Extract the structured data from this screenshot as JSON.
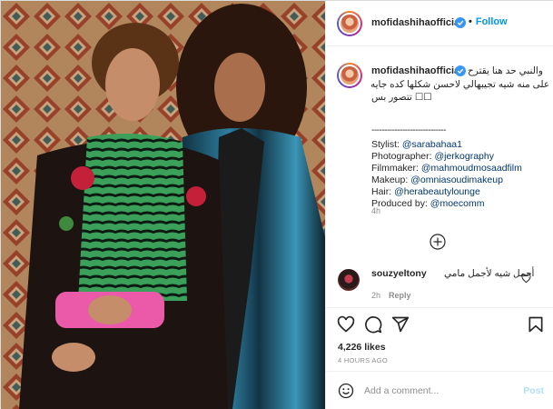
{
  "header": {
    "username": "mofidashihaofficial",
    "follow_label": "Follow",
    "separator": "•",
    "more": "•••"
  },
  "caption": {
    "username": "mofidashihaofficial",
    "line1": "والنبي حد هنا يقترح",
    "line2": "على منه شيه تجيبهالي لاحسن شكلها كده جايه",
    "line3": "تتصور بس ☐☐",
    "dashes": "-----------------------------",
    "credits": [
      {
        "label": "Stylist: ",
        "handle": "@sarabahaa1"
      },
      {
        "label": "Photographer: ",
        "handle": "@jerkography"
      },
      {
        "label": "Filmmaker: ",
        "handle": "@mahmoudmosaadfilm"
      },
      {
        "label": "Makeup: ",
        "handle": "@omniasoudimakeup"
      },
      {
        "label": "Hair: ",
        "handle": "@herabeautylounge"
      },
      {
        "label": "Produced by: ",
        "handle": "@moecomm"
      }
    ],
    "time": "4h"
  },
  "comment": {
    "username": "souzyeltony",
    "text": "أجمل شيه لأجمل مامي",
    "time": "2h",
    "reply_label": "Reply"
  },
  "stats": {
    "likes": "4,226 likes",
    "posted": "4 HOURS AGO"
  },
  "add_comment": {
    "placeholder": "Add a comment...",
    "post_label": "Post"
  },
  "icons": [
    "verified-badge-icon",
    "more-options-icon",
    "load-more-icon",
    "heart-icon",
    "comment-icon",
    "share-icon",
    "bookmark-icon",
    "emoji-icon"
  ],
  "colors": {
    "link": "#00376b",
    "follow": "#0095f6",
    "post_disabled": "#b2dffc",
    "muted": "#8e8e8e"
  }
}
